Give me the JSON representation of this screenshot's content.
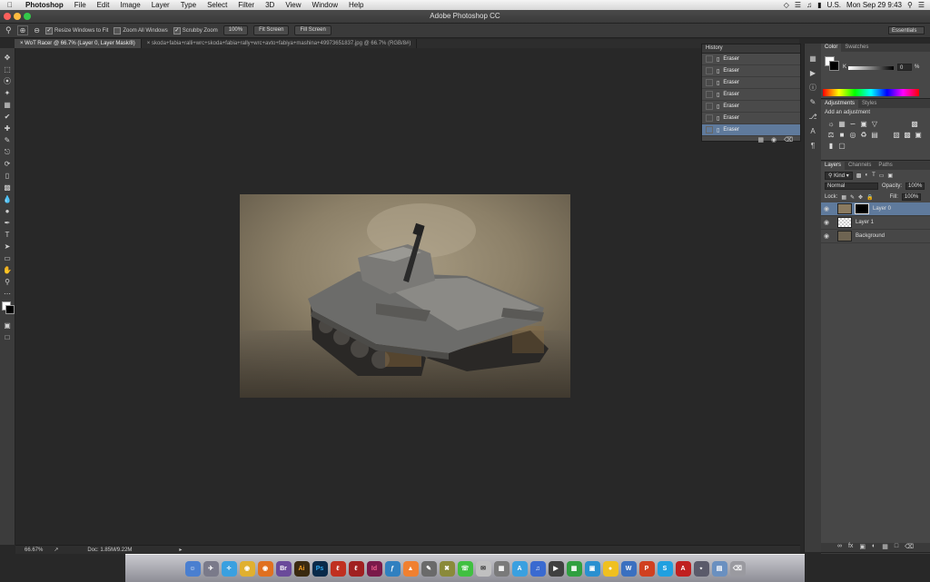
{
  "menubar": {
    "apple": "",
    "items": [
      "Photoshop",
      "File",
      "Edit",
      "Image",
      "Layer",
      "Type",
      "Select",
      "Filter",
      "3D",
      "View",
      "Window",
      "Help"
    ],
    "lang": "U.S.",
    "clock": "Mon Sep 29  9:43"
  },
  "window": {
    "title": "Adobe Photoshop CC"
  },
  "options": {
    "resize": "Resize Windows to Fit",
    "zoom_all": "Zoom All Windows",
    "scrubby": "Scrubby Zoom",
    "b100": "100%",
    "fit": "Fit Screen",
    "fill": "Fill Screen",
    "workspace": "Essentials"
  },
  "tabs": [
    {
      "label": "WoT Racer @ 66.7% (Layer 0, Layer Mask/8)"
    },
    {
      "label": "skoda+fabia+ralli+wrc+skoda+fabia+rally+wrc+avto+fabiya+mashina+49973651837.jpg @ 66.7% (RGB/8#)"
    }
  ],
  "status": {
    "zoom": "66.67%",
    "doc": "Doc: 1.85M/9.22M"
  },
  "history": {
    "title": "History",
    "items": [
      "Eraser",
      "Eraser",
      "Eraser",
      "Eraser",
      "Eraser",
      "Eraser",
      "Eraser"
    ]
  },
  "color_panel": {
    "tabs": [
      "Color",
      "Swatches"
    ],
    "k_label": "K",
    "k_value": "0",
    "k_unit": "%"
  },
  "adjustments": {
    "tabs": [
      "Adjustments",
      "Styles"
    ],
    "heading": "Add an adjustment"
  },
  "layers": {
    "tabs": [
      "Layers",
      "Channels",
      "Paths"
    ],
    "kind": "Kind",
    "blend": "Normal",
    "opacity_label": "Opacity:",
    "opacity": "100%",
    "lock_label": "Lock:",
    "fill_label": "Fill:",
    "fill": "100%",
    "items": [
      {
        "name": "Layer 0"
      },
      {
        "name": "Layer 1"
      },
      {
        "name": "Background"
      }
    ]
  },
  "dock": {
    "apps": [
      "finder",
      "launchpad",
      "safari",
      "chrome",
      "firefox",
      "adobe-bridge",
      "illustrator",
      "photoshop",
      "acrobat",
      "acrobat-pro",
      "indesign",
      "xd",
      "music",
      "text",
      "download",
      "tools",
      "mail",
      "itunes",
      "messages",
      "app-store",
      "photos",
      "calendar",
      "notes",
      "vlc",
      "paint",
      "powerpoint",
      "skype",
      "adobe",
      "bluetooth",
      "folder",
      "trash"
    ]
  }
}
